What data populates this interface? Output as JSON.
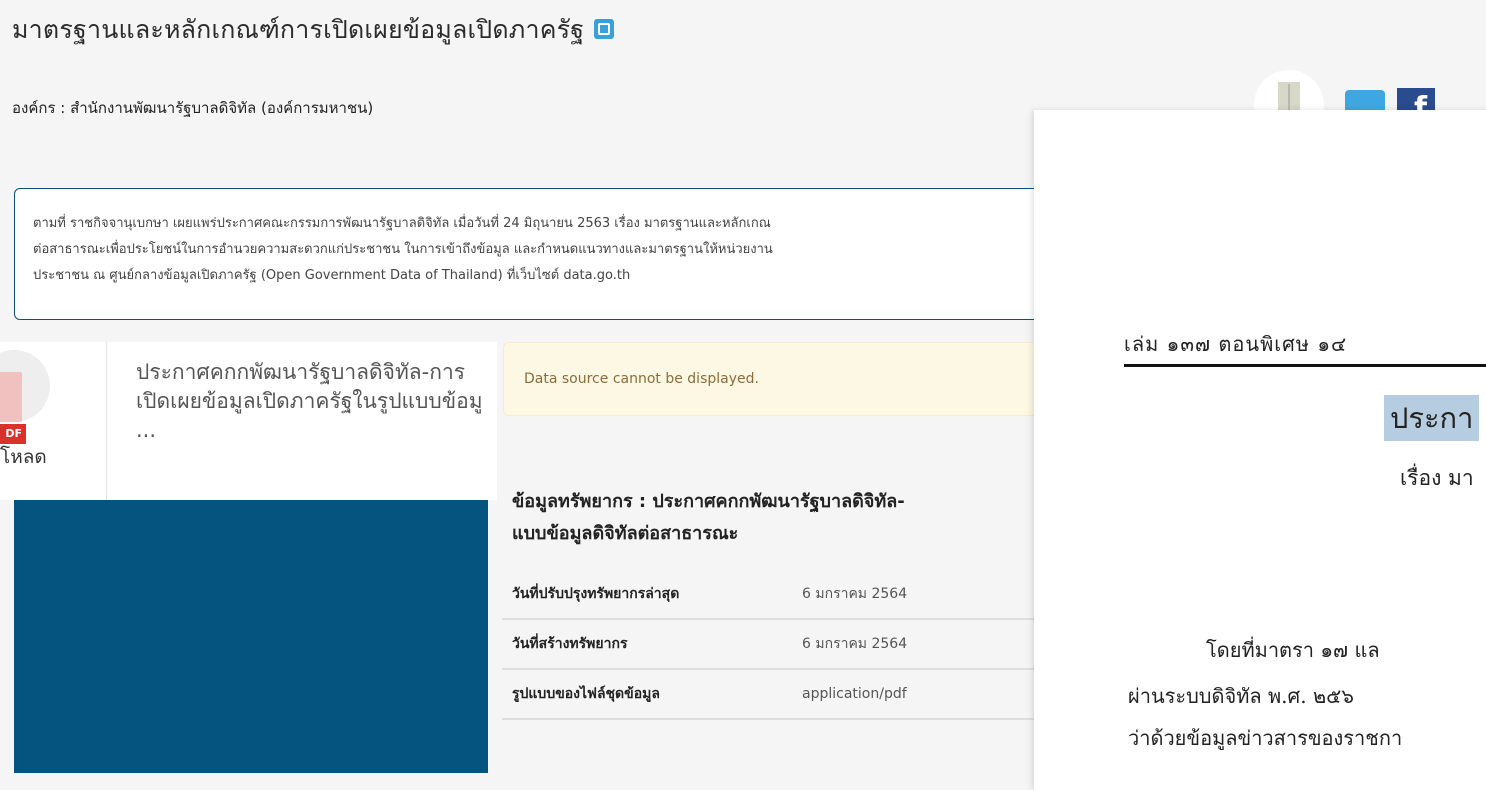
{
  "page": {
    "title": "มาตรฐานและหลักเกณฑ์การเปิดเผยข้อมูลเปิดภาครัฐ",
    "organization": "องค์กร : สำนักงานพัฒนารัฐบาลดิจิทัล (องค์การมหาชน)"
  },
  "description": {
    "line1": "ตามที่ ราชกิจจานุเบกษา เผยแพร่ประกาศคณะกรรมการพัฒนารัฐบาลดิจิทัล เมื่อวันที่ 24 มิถุนายน 2563 เรื่อง มาตรฐานและหลักเกณ",
    "line2": "ต่อสาธารณะเพื่อประโยชน์ในการอำนวยความสะดวกแก่ประชาชน ในการเข้าถึงข้อมูล และกำหนดแนวทางและมาตรฐานให้หน่วยงาน",
    "line3": "ประชาชน ณ ศูนย์กลางข้อมูลเปิดภาครัฐ (Open Government Data of Thailand) ที่เว็บไซต์ data.go.th"
  },
  "social": {
    "facebook_glyph": "f"
  },
  "resource_card": {
    "pdf_label": "DF",
    "download_label": "โหลด",
    "title": "ประกาศคกกพัฒนารัฐบาลดิจิทัล-การเปิดเผยข้อมูลเปิดภาครัฐในรูปแบบข้อมู ..."
  },
  "alert": {
    "text": "Data source cannot be displayed."
  },
  "resource_info": {
    "heading": "ข้อมูลทรัพยากร : ประกาศคกกพัฒนารัฐบาลดิจิทัล-",
    "heading_line2": "แบบข้อมูลดิจิทัลต่อสาธารณะ",
    "rows": [
      {
        "key": "วันที่ปรับปรุงทรัพยากรล่าสุด",
        "value": "6 มกราคม 2564"
      },
      {
        "key": "วันที่สร้างทรัพยากร",
        "value": "6 มกราคม 2564"
      },
      {
        "key": "รูปแบบของไฟล์ชุดข้อมูล",
        "value": "application/pdf"
      }
    ]
  },
  "document_preview": {
    "header": "เล่ม ๑๓๗ ตอนพิเศษ ๑๔",
    "title": "ประกา",
    "subject": "เรื่อง มา",
    "line1": "โดยที่มาตรา ๑๗ แล",
    "line2": "ผ่านระบบดิจิทัล พ.ศ. ๒๕๖",
    "line3": "ว่าด้วยข้อมูลข่าวสารของราชกา"
  }
}
